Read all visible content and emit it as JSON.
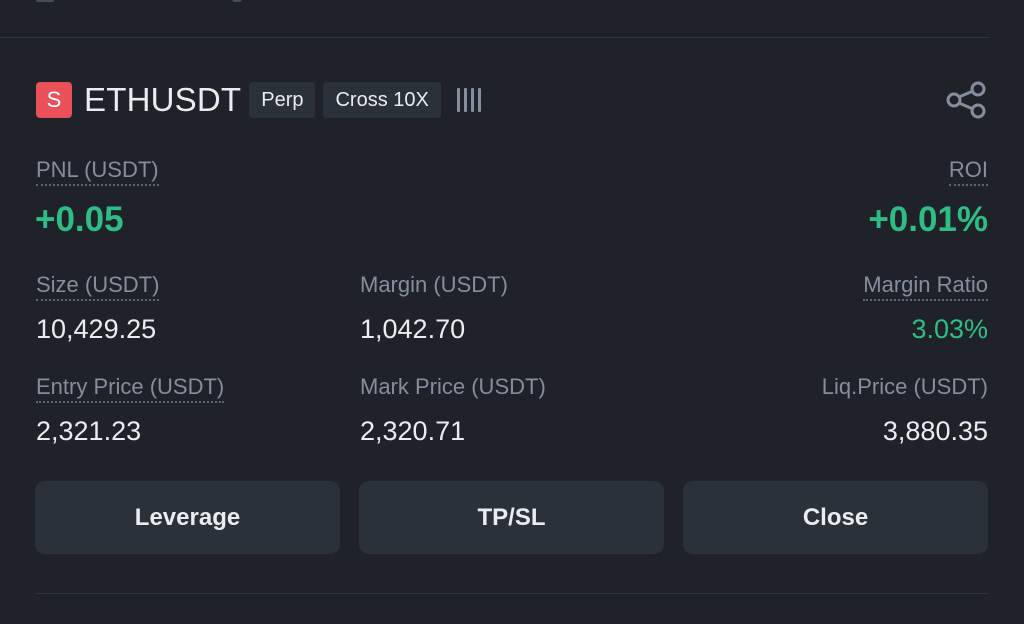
{
  "position": {
    "symbol_badge": "S",
    "symbol": "ETHUSDT",
    "tags": [
      "Perp",
      "Cross 10X"
    ],
    "pnl": {
      "label": "PNL (USDT)",
      "value": "+0.05"
    },
    "roi": {
      "label": "ROI",
      "value": "+0.01%"
    },
    "size": {
      "label": "Size (USDT)",
      "value": "10,429.25"
    },
    "margin": {
      "label": "Margin (USDT)",
      "value": "1,042.70"
    },
    "margin_ratio": {
      "label": "Margin Ratio",
      "value": "3.03%"
    },
    "entry_price": {
      "label": "Entry Price (USDT)",
      "value": "2,321.23"
    },
    "mark_price": {
      "label": "Mark Price (USDT)",
      "value": "2,320.71"
    },
    "liq_price": {
      "label": "Liq.Price (USDT)",
      "value": "3,880.35"
    }
  },
  "actions": {
    "leverage": "Leverage",
    "tpsl": "TP/SL",
    "close": "Close"
  },
  "icons": {
    "share": "share-icon",
    "signal": "signal-bars-icon"
  },
  "colors": {
    "background": "#1f2329",
    "positive": "#2ebd85",
    "badge": "#e9505a",
    "muted": "#848e9c"
  }
}
